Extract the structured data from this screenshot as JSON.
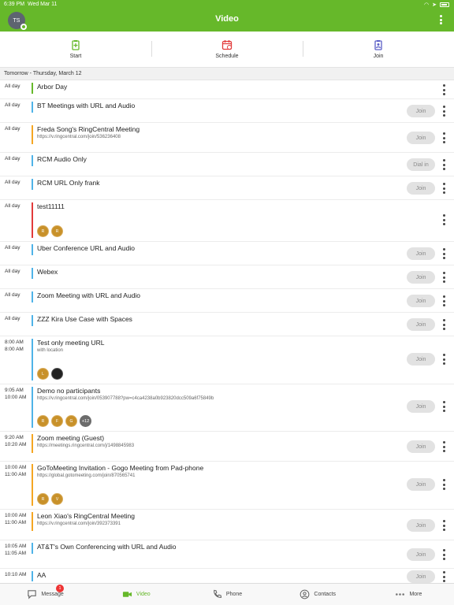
{
  "status": {
    "time": "6:39 PM",
    "date": "Wed Mar 11",
    "battery": "77%"
  },
  "header": {
    "avatar_initials": "TS",
    "title": "Video"
  },
  "actions": [
    {
      "label": "Start",
      "icon": "start-meeting-icon",
      "color": "#66b82a"
    },
    {
      "label": "Schedule",
      "icon": "calendar-icon",
      "color": "#e23b3b"
    },
    {
      "label": "Join",
      "icon": "join-badge-icon",
      "color": "#5b5fc7"
    }
  ],
  "date_header": "Tomorrow - Thursday, March 12",
  "meetings": [
    {
      "start": "All day",
      "end": "",
      "title": "Arbor Day",
      "subtitle": "",
      "bar_color": "#66b82a",
      "button": ""
    },
    {
      "start": "All day",
      "end": "",
      "title": "BT Meetings with URL and Audio",
      "subtitle": "",
      "bar_color": "#4fb3e8",
      "button": "Join"
    },
    {
      "start": "All day",
      "end": "",
      "title": "Freda Song's RingCentral Meeting",
      "subtitle": "https://v.ringcentral.com/join/536236408",
      "bar_color": "#f5a623",
      "button": "Join"
    },
    {
      "start": "All day",
      "end": "",
      "title": "RCM Audio Only",
      "subtitle": "",
      "bar_color": "#4fb3e8",
      "button": "Dial in"
    },
    {
      "start": "All day",
      "end": "",
      "title": "RCM URL Only frank",
      "subtitle": "",
      "bar_color": "#4fb3e8",
      "button": "Join"
    },
    {
      "start": "All day",
      "end": "",
      "title": "test11111",
      "subtitle": "",
      "bar_color": "#e23b3b",
      "button": "",
      "participants": [
        "R",
        "R"
      ]
    },
    {
      "start": "All day",
      "end": "",
      "title": "Uber Conference URL and Audio",
      "subtitle": "",
      "bar_color": "#4fb3e8",
      "button": "Join"
    },
    {
      "start": "All day",
      "end": "",
      "title": "Webex",
      "subtitle": "",
      "bar_color": "#4fb3e8",
      "button": "Join"
    },
    {
      "start": "All day",
      "end": "",
      "title": "Zoom Meeting with URL and Audio",
      "subtitle": "",
      "bar_color": "#4fb3e8",
      "button": "Join"
    },
    {
      "start": "All day",
      "end": "",
      "title": "ZZZ Kira Use Case with Spaces",
      "subtitle": "",
      "bar_color": "#4fb3e8",
      "button": "Join"
    },
    {
      "start": "8:00 AM",
      "end": "8:00 AM",
      "title": "Test only meeting URL",
      "subtitle": "with location",
      "bar_color": "#4fb3e8",
      "button": "Join",
      "participants": [
        "L",
        ""
      ]
    },
    {
      "start": "9:05 AM",
      "end": "10:00 AM",
      "title": "Demo no participants",
      "subtitle": "https://v.ringcentral.com/join/053907788?pw=c4ca4238a0b923820dcc509a6f75849b",
      "bar_color": "#4fb3e8",
      "button": "Join",
      "participants": [
        "R",
        "F",
        "G",
        "+12"
      ]
    },
    {
      "start": "9:20 AM",
      "end": "10:20 AM",
      "title": "Zoom meeting (Guest)",
      "subtitle": "https://meetings.ringcentral.com/j/1498845983",
      "bar_color": "#f5a623",
      "button": "Join"
    },
    {
      "start": "10:00 AM",
      "end": "11:00 AM",
      "title": "GoToMeeting Invitation - Gogo Meeting from Pad-phone",
      "subtitle": "https://global.gotomeeting.com/join/870565741",
      "bar_color": "#f5a623",
      "button": "Join",
      "participants": [
        "R",
        "V"
      ]
    },
    {
      "start": "10:00 AM",
      "end": "11:00 AM",
      "title": "Leon Xiao's RingCentral Meeting",
      "subtitle": "https://v.ringcentral.com/join/392373391",
      "bar_color": "#f5a623",
      "button": "Join"
    },
    {
      "start": "10:05 AM",
      "end": "11:05 AM",
      "title": "AT&T's Own Conferencing with URL and Audio",
      "subtitle": "",
      "bar_color": "#4fb3e8",
      "button": "Join"
    },
    {
      "start": "10:10 AM",
      "end": "",
      "title": "AA",
      "subtitle": "",
      "bar_color": "#4fb3e8",
      "button": "Join"
    }
  ],
  "tabs": [
    {
      "label": "Message",
      "icon": "message-icon",
      "badge": "1"
    },
    {
      "label": "Video",
      "icon": "video-icon",
      "active": true
    },
    {
      "label": "Phone",
      "icon": "phone-icon"
    },
    {
      "label": "Contacts",
      "icon": "contacts-icon"
    },
    {
      "label": "More",
      "icon": "more-icon"
    }
  ],
  "colors": {
    "brand_green": "#66b82a",
    "join_button_bg": "#e2e2e2"
  }
}
